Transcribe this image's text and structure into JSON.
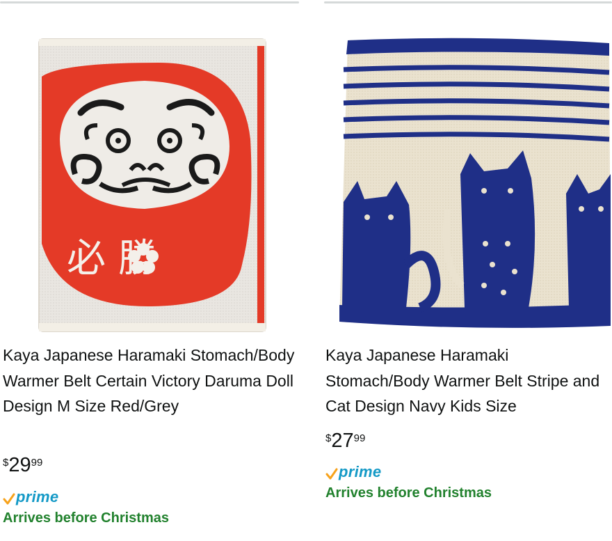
{
  "products": [
    {
      "title": "Kaya Japanese Haramaki Stomach/Body Warmer Belt Certain Victory Daruma Doll Design M Size Red/Grey",
      "price_symbol": "$",
      "price_whole": "29",
      "price_fraction": "99",
      "prime_label": "prime",
      "delivery": "Arrives before Christmas",
      "image_icon": "daruma-haramaki-image",
      "image_text": "必 勝"
    },
    {
      "title": "Kaya Japanese Haramaki Stomach/Body Warmer Belt Stripe and Cat Design Navy Kids Size",
      "price_symbol": "$",
      "price_whole": "27",
      "price_fraction": "99",
      "prime_label": "prime",
      "delivery": "Arrives before Christmas",
      "image_icon": "cat-stripe-haramaki-image"
    }
  ],
  "colors": {
    "prime_blue": "#1399c6",
    "prime_check": "#f7a21b",
    "delivery_green": "#21812d",
    "daruma_red": "#e43a27",
    "navy": "#1f2f87",
    "knit_cream": "#efe7d6"
  }
}
